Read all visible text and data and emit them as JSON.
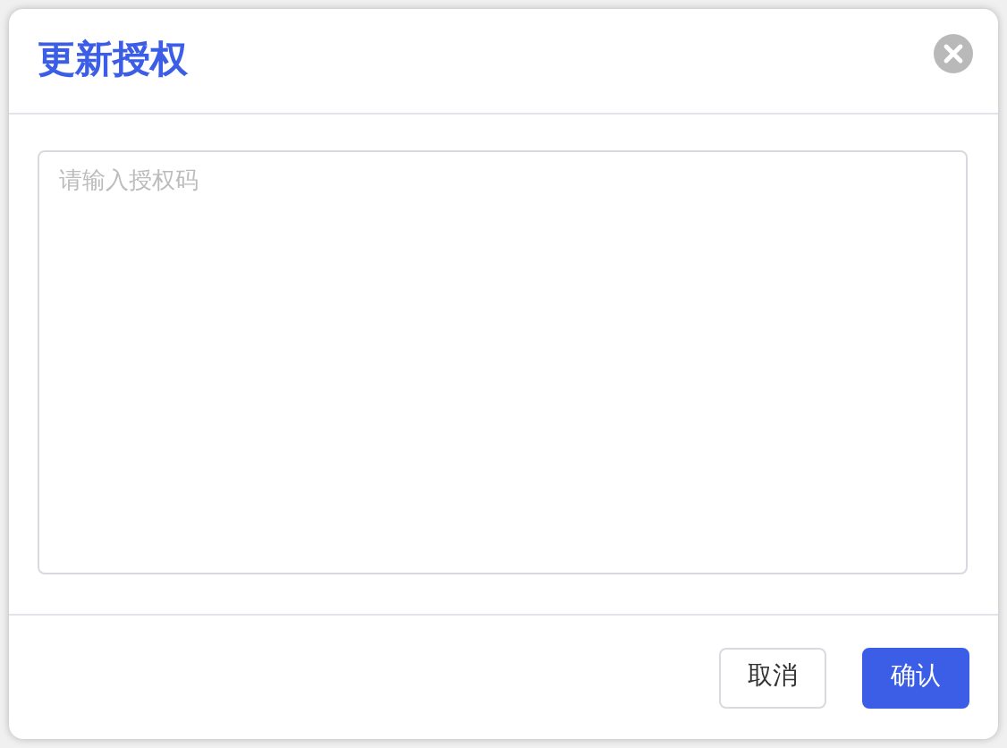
{
  "dialog": {
    "title": "更新授权"
  },
  "textarea": {
    "placeholder": "请输入授权码"
  },
  "buttons": [
    {
      "label": "取消",
      "kind": "default"
    },
    {
      "label": "确认",
      "kind": "primary"
    }
  ]
}
